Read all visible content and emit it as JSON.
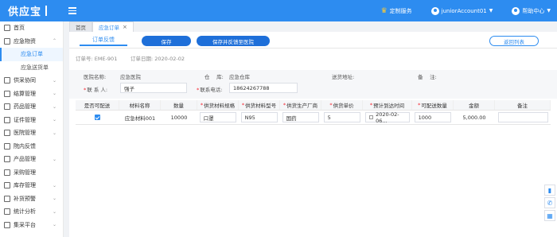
{
  "app": {
    "logo": "供应宝"
  },
  "topbar": {
    "custom_service": "定制服务",
    "account": "juniorAccount01",
    "help": "帮助中心"
  },
  "sidebar": {
    "items": [
      {
        "label": "首页",
        "icon": "home-icon",
        "arrow": false
      },
      {
        "label": "应急物资",
        "icon": "box-icon",
        "arrow": true,
        "open": true
      },
      {
        "label": "应急订单",
        "sub": true,
        "active": true
      },
      {
        "label": "应急送货单",
        "sub": true
      },
      {
        "label": "供采协同",
        "icon": "handshake-icon",
        "arrow": true
      },
      {
        "label": "结算管理",
        "icon": "settlement-icon",
        "arrow": true
      },
      {
        "label": "药品管理",
        "icon": "medicine-icon",
        "arrow": true
      },
      {
        "label": "证件管理",
        "icon": "certificate-icon",
        "arrow": true
      },
      {
        "label": "医院管理",
        "icon": "hospital-icon",
        "arrow": true
      },
      {
        "label": "院内反馈",
        "icon": "feedback-icon",
        "arrow": false
      },
      {
        "label": "产品管理",
        "icon": "product-icon",
        "arrow": true
      },
      {
        "label": "采购管理",
        "icon": "purchase-icon",
        "arrow": false
      },
      {
        "label": "库存管理",
        "icon": "inventory-icon",
        "arrow": true
      },
      {
        "label": "补货预警",
        "icon": "alert-icon",
        "arrow": true
      },
      {
        "label": "统计分析",
        "icon": "chart-icon",
        "arrow": true
      },
      {
        "label": "集采平台",
        "icon": "platform-icon",
        "arrow": true
      }
    ]
  },
  "tabs": [
    {
      "label": "首页"
    },
    {
      "label": "应急订单",
      "closable": true
    }
  ],
  "toolbar": {
    "subtab": "订单反馈",
    "save": "保存",
    "save_feedback": "保存并反馈至医院",
    "back": "返回列表"
  },
  "meta": {
    "order_no": "订单号: EME-901",
    "order_date": "订单日期:  2020-02-02"
  },
  "info": {
    "hospital_label": "医院名称:",
    "hospital_value": "应急医院",
    "warehouse_label": "仓　 库:",
    "warehouse_value": "应急仓库",
    "address_label": "送货地址:",
    "remark_label": "备　 注:",
    "contact_label": "联 系 人:",
    "contact_value": "强子",
    "phone_label": "联系电话:",
    "phone_value": "18624267788"
  },
  "table": {
    "headers": [
      "是否可配送",
      "材料名称",
      "数量",
      "供货材料规格",
      "供货材料型号",
      "供货生产厂商",
      "供货单价",
      "预计到达时间",
      "可配送数量",
      "金额",
      "备注"
    ],
    "required": [
      false,
      false,
      false,
      true,
      true,
      true,
      true,
      true,
      true,
      false,
      false
    ],
    "rows": [
      {
        "deliverable": true,
        "name": "应急材料001",
        "qty": "10000",
        "spec": "口罩",
        "model": "N95",
        "maker": "国药",
        "price": "5",
        "eta": "2020-02-06...",
        "deliver_qty": "1000",
        "amount": "5,000.00",
        "remark": ""
      }
    ]
  },
  "floating": [
    "bar-chart-icon",
    "phone-icon",
    "qrcode-icon"
  ],
  "colors": {
    "primary": "#2d8cf0",
    "button": "#1e6fd9",
    "required": "#f5222d"
  }
}
